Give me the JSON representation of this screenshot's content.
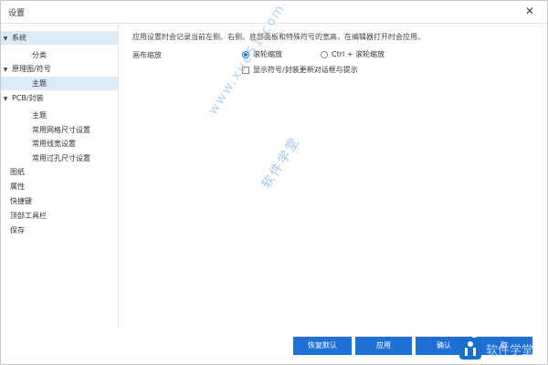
{
  "window": {
    "title": "设置",
    "close_glyph": "✕"
  },
  "sidebar": {
    "items": [
      {
        "label": "系统",
        "selected": true,
        "expander": "▼"
      },
      {
        "label": "分类"
      },
      {
        "label": "原理图/符号",
        "expander": "▼"
      },
      {
        "label": "主题",
        "selected": true
      },
      {
        "label": "PCB/封装",
        "expander": "▼"
      },
      {
        "label": "主题"
      },
      {
        "label": "常用网格尺寸设置"
      },
      {
        "label": "常用线宽设置"
      },
      {
        "label": "常用过孔尺寸设置"
      },
      {
        "label": "图纸"
      },
      {
        "label": "属性"
      },
      {
        "label": "快捷键"
      },
      {
        "label": "顶部工具栏"
      },
      {
        "label": "保存"
      }
    ]
  },
  "content": {
    "description": "应用设置时会记录当前左侧、右侧、底部面板和特殊符号的宽高，在编辑器打开时会应用。",
    "zoom": {
      "label": "画布缩放",
      "options": [
        {
          "label": "滚轮缩放",
          "selected": true
        },
        {
          "label": "Ctrl + 滚轮缩放",
          "selected": false
        }
      ]
    },
    "checkbox": {
      "label": "显示符号/封装更新对话框与提示",
      "checked": false
    }
  },
  "footer": {
    "restore_label": "恢复默认",
    "apply_label": "应用",
    "ok_label": "确认",
    "cancel_label": "取"
  },
  "watermark": {
    "url": "www.xue51.com",
    "name": "软件学堂",
    "logo_text": "软件学堂"
  }
}
